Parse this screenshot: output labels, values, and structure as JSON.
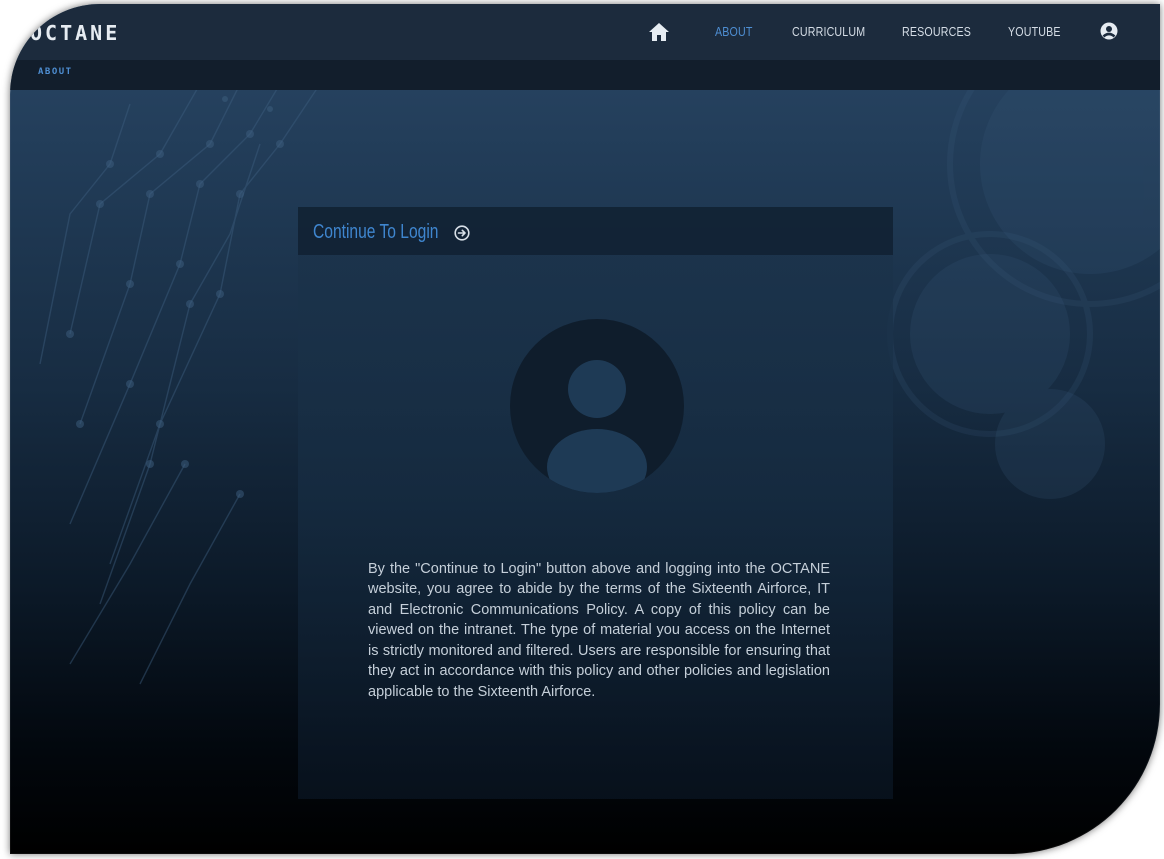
{
  "brand": {
    "name": "OCTANE"
  },
  "nav": {
    "home_icon": "home-icon",
    "items": [
      {
        "label": "ABOUT",
        "active": true
      },
      {
        "label": "CURRICULUM",
        "active": false
      },
      {
        "label": "RESOURCES",
        "active": false
      },
      {
        "label": "YOUTUBE",
        "active": false
      }
    ],
    "user_icon": "user-circle-icon"
  },
  "breadcrumb": {
    "current": "ABOUT"
  },
  "card": {
    "login_label": "Continue To Login",
    "login_icon": "arrow-circle-right-icon",
    "avatar_icon": "user-avatar-icon",
    "policy_text": "By the \"Continue to Login\" button above and logging into the OCTANE website, you agree to abide by the terms of the Sixteenth Airforce, IT and Electronic Communications Policy. A copy of this policy can be viewed on the intranet. The type of material you access on the Internet is strictly monitored and filtered. Users are responsible for ensuring that they act in accordance with this policy and other policies and legislation applicable to the Sixteenth Airforce."
  },
  "colors": {
    "accent": "#3f86cf",
    "navbar": "#1c2b3d",
    "text": "#c5cfd9",
    "avatar": "#0f1d2c"
  }
}
